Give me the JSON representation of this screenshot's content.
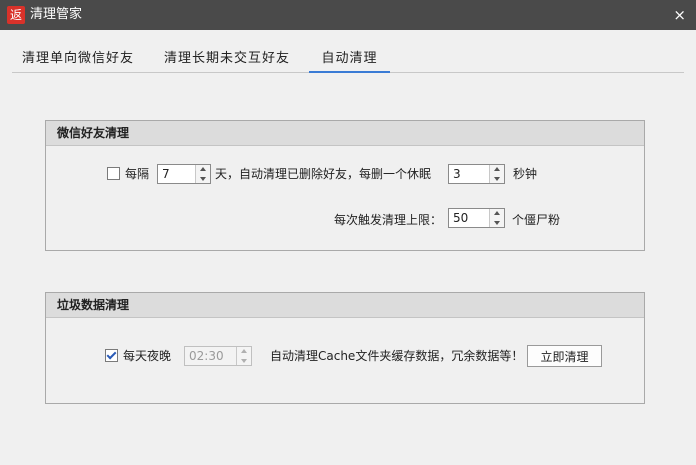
{
  "window": {
    "title": "清理管家",
    "icon_char": "返",
    "close_char": "×"
  },
  "tabs": [
    {
      "label": "清理单向微信好友",
      "active": false
    },
    {
      "label": "清理长期未交互好友",
      "active": false
    },
    {
      "label": "自动清理",
      "active": true
    }
  ],
  "wechat_group": {
    "title": "微信好友清理",
    "interval_checked": false,
    "interval_label": "每隔",
    "interval_value": "7",
    "interval_text": "天，自动清理已删除好友，每删一个休眠",
    "sleep_value": "3",
    "sleep_unit": "秒钟",
    "limit_label": "每次触发清理上限：",
    "limit_value": "50",
    "limit_unit": "个僵尸粉"
  },
  "junk_group": {
    "title": "垃圾数据清理",
    "nightly_checked": true,
    "nightly_label": "每天夜晚",
    "time_value": "02:30",
    "description": "自动清理Cache文件夹缓存数据，冗余数据等！",
    "clean_button": "立即清理"
  }
}
